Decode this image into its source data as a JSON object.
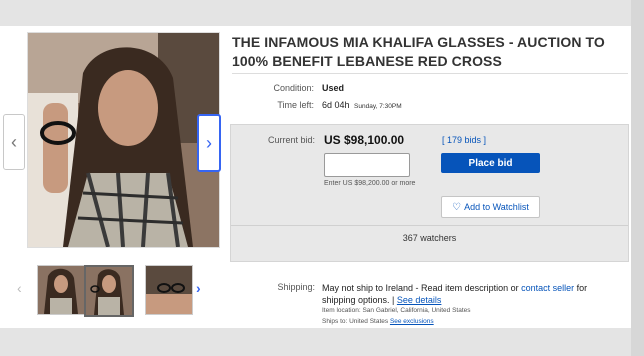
{
  "listing": {
    "title": "THE INFAMOUS MIA KHALIFA GLASSES - AUCTION TO 100% BENEFIT LEBANESE RED CROSS"
  },
  "details": {
    "condition_label": "Condition:",
    "condition_value": "Used",
    "time_left_label": "Time left:",
    "time_left_value": "6d 04h",
    "time_left_detail": "Sunday, 7:30PM"
  },
  "bid": {
    "current_bid_label": "Current bid:",
    "current_bid_value": "US $98,100.00",
    "bids_link": "[ 179 bids ]",
    "input_placeholder": "",
    "enter_hint": "Enter US $98,200.00 or more",
    "place_bid_label": "Place bid",
    "watchlist_label": "Add to Watchlist",
    "watchers_text": "367 watchers"
  },
  "shipping": {
    "label": "Shipping:",
    "text_before": "May not ship to Ireland - Read item description or ",
    "contact_link": "contact seller",
    "text_after": " for shipping options. | ",
    "see_details": "See details",
    "item_location": "Item location:  San Gabriel, California, United States",
    "ships_to_prefix": "Ships to:  United States  ",
    "see_exclusions": "See exclusions"
  },
  "gallery": {
    "prev_arrow": "‹",
    "next_arrow": "›",
    "thumb_prev": "‹",
    "thumb_next": "›"
  },
  "icons": {
    "heart": "heart-icon",
    "chevron_left": "chevron-left-icon",
    "chevron_right": "chevron-right-icon"
  },
  "colors": {
    "accent": "#0654ba",
    "selected_nav": "#3665f3"
  }
}
